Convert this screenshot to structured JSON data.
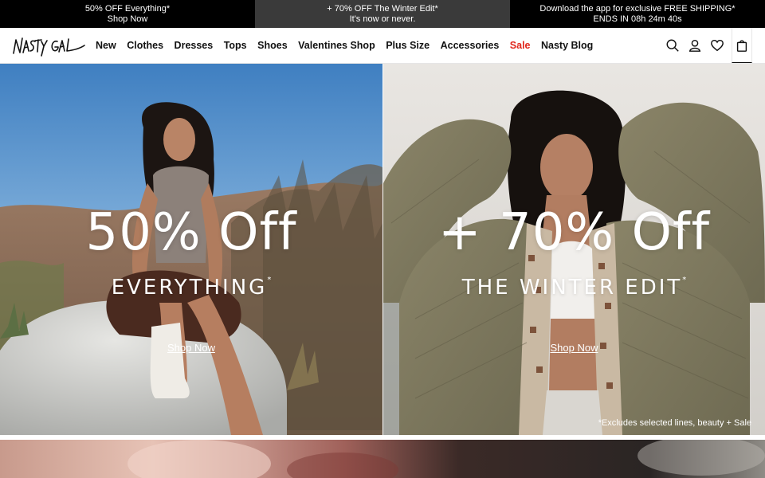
{
  "promo": [
    {
      "line1": "50% OFF Everything*",
      "line2": "Shop Now"
    },
    {
      "line1": "+ 70% OFF The Winter Edit*",
      "line2": "It's now or never."
    },
    {
      "line1": "Download the app for exclusive FREE SHIPPING*",
      "line2": "ENDS IN 08h 24m 40s"
    }
  ],
  "nav": {
    "logo_text": "NASTY GAL",
    "items": [
      "New",
      "Clothes",
      "Dresses",
      "Tops",
      "Shoes",
      "Valentines Shop",
      "Plus Size",
      "Accessories",
      "Sale",
      "Nasty Blog"
    ],
    "icons": [
      "search-icon",
      "account-icon",
      "wishlist-icon",
      "bag-icon"
    ]
  },
  "hero_left": {
    "headline": "50% Off",
    "subline": "EVERYTHING",
    "asterisk": "*",
    "link": "Shop Now"
  },
  "hero_right": {
    "headline": "+ 70% Off",
    "subline": "THE WINTER EDIT",
    "asterisk": "*",
    "link": "Shop Now",
    "disclaimer": "*Excludes selected lines, beauty + Sale"
  },
  "colors": {
    "promo_dark": "#000000",
    "promo_mid": "#3a3a3a",
    "sale_red": "#e0271c"
  }
}
